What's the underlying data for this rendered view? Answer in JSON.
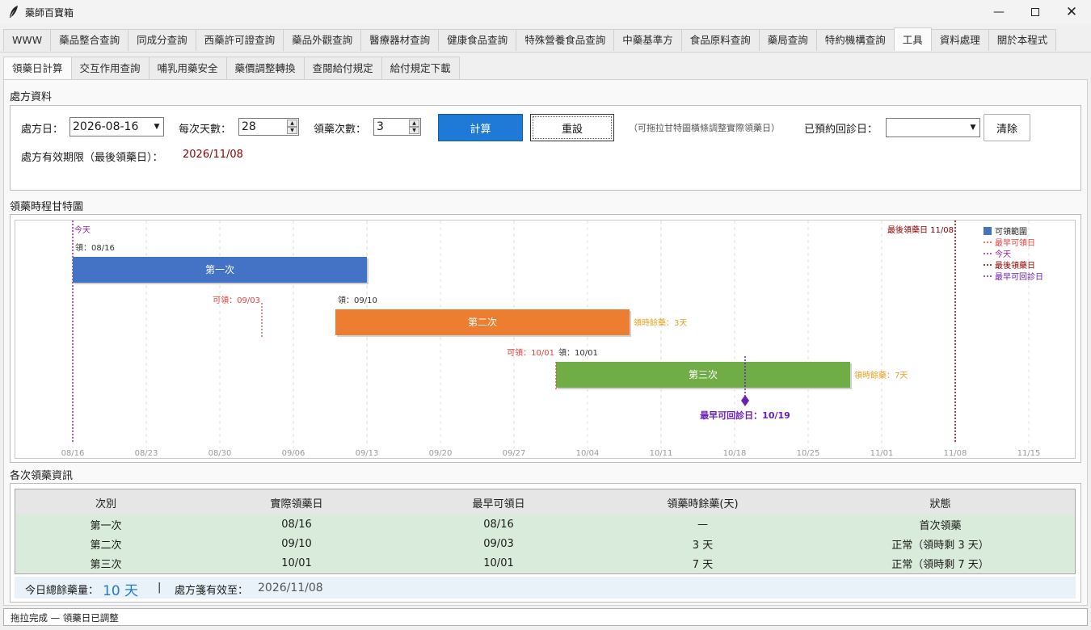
{
  "window": {
    "title": "藥師百寶箱",
    "icons": {
      "app": "feather-icon",
      "minimize": "minimize-icon",
      "maximize": "maximize-icon",
      "close": "close-icon"
    }
  },
  "main_tabs": [
    "WWW",
    "藥品整合查詢",
    "同成分查詢",
    "西藥許可證查詢",
    "藥品外觀查詢",
    "醫療器材查詢",
    "健康食品查詢",
    "特殊營養食品查詢",
    "中藥基準方",
    "食品原料查詢",
    "藥局查詢",
    "特約機構查詢",
    "工具",
    "資料處理",
    "關於本程式"
  ],
  "main_tab_active": "工具",
  "sub_tabs": [
    "領藥日計算",
    "交互作用查詢",
    "哺乳用藥安全",
    "藥價調整轉換",
    "查閱給付規定",
    "給付規定下載"
  ],
  "sub_tab_active": "領藥日計算",
  "prescription": {
    "section_title": "處方資料",
    "date_label": "處方日：",
    "date_value": "2026-08-16",
    "days_label": "每次天數：",
    "days_value": "28",
    "times_label": "領藥次數：",
    "times_value": "3",
    "calc_button": "計算",
    "reset_button": "重設",
    "hint": "（可拖拉甘特圖橫條調整實際領藥日）",
    "revisit_label": "已預約回診日：",
    "revisit_value": "",
    "clear_button": "清除",
    "validity_label": "處方有效期限（最後領藥日）：",
    "validity_value": "2026/11/08"
  },
  "gantt": {
    "section_title": "領藥時程甘特圖",
    "today_label": "今天",
    "last_day_label": "最後領藥日 11/08",
    "legend": [
      {
        "label": "可領範圍",
        "color": "#4472c4",
        "style": "box"
      },
      {
        "label": "最早可領日",
        "color": "#e8413c",
        "style": "dotted"
      },
      {
        "label": "今天",
        "color": "#a020a0",
        "style": "dotted"
      },
      {
        "label": "最後領藥日",
        "color": "#8b0000",
        "style": "dotted"
      },
      {
        "label": "最早可回診日",
        "color": "#6a1fb5",
        "style": "dotted"
      }
    ],
    "bars": [
      {
        "label": "第一次",
        "start": "08/16",
        "end": "09/13",
        "color": "#4472c4",
        "pickup_label": "領：08/16",
        "earliest_label": "",
        "remaining_label": ""
      },
      {
        "label": "第二次",
        "start": "09/10",
        "end": "10/08",
        "color": "#ed7d31",
        "pickup_label": "領：09/10",
        "earliest_label": "可領：09/03",
        "earliest": "09/03",
        "remaining_label": "領時餘藥：3天"
      },
      {
        "label": "第三次",
        "start": "10/01",
        "end": "10/29",
        "color": "#70ad47",
        "pickup_label": "領：10/01",
        "earliest_label": "可領：10/01",
        "earliest": "10/01",
        "remaining_label": "領時餘藥：7天"
      }
    ],
    "revisit_marker": {
      "date": "10/19",
      "label": "最早可回診日：10/19"
    },
    "today": "08/16",
    "last_day": "11/08",
    "x_range": [
      "08/16",
      "11/19"
    ],
    "x_ticks": [
      "08/16",
      "08/23",
      "08/30",
      "09/06",
      "09/13",
      "09/20",
      "09/27",
      "10/04",
      "10/11",
      "10/18",
      "10/25",
      "11/01",
      "11/08",
      "11/15"
    ]
  },
  "table": {
    "section_title": "各次領藥資訊",
    "headers": [
      "次別",
      "實際領藥日",
      "最早可領日",
      "領藥時餘藥(天)",
      "狀態"
    ],
    "rows": [
      [
        "第一次",
        "08/16",
        "08/16",
        "—",
        "首次領藥"
      ],
      [
        "第二次",
        "09/10",
        "09/03",
        "3 天",
        "正常（領時剩 3 天）"
      ],
      [
        "第三次",
        "10/01",
        "10/01",
        "7 天",
        "正常（領時剩 7 天）"
      ]
    ]
  },
  "summary": {
    "remaining_label": "今日總餘藥量：",
    "remaining_value": "10 天",
    "separator": "|",
    "valid_label": "處方箋有效至：",
    "valid_value": "2026/11/08"
  },
  "status_bar": "拖拉完成 — 領藥日已調整"
}
